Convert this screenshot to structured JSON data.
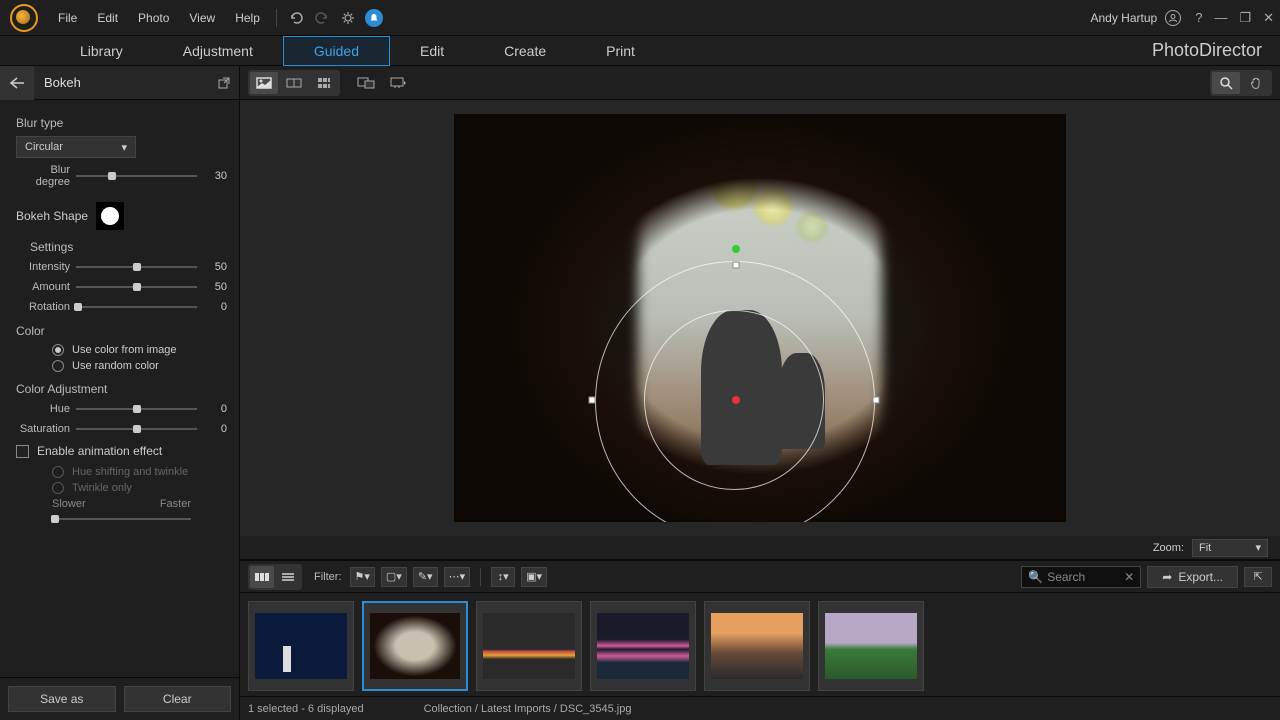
{
  "menu": {
    "file": "File",
    "edit": "Edit",
    "photo": "Photo",
    "view": "View",
    "help": "Help"
  },
  "user": {
    "name": "Andy Hartup"
  },
  "brand": "PhotoDirector",
  "tabs": {
    "library": "Library",
    "adjustment": "Adjustment",
    "guided": "Guided",
    "edit": "Edit",
    "create": "Create",
    "print": "Print"
  },
  "panel": {
    "title": "Bokeh",
    "blur_type_label": "Blur type",
    "blur_type_value": "Circular",
    "blur_degree_label": "Blur degree",
    "blur_degree_value": "30",
    "bokeh_shape_label": "Bokeh Shape",
    "settings_label": "Settings",
    "intensity_label": "Intensity",
    "intensity_value": "50",
    "amount_label": "Amount",
    "amount_value": "50",
    "rotation_label": "Rotation",
    "rotation_value": "0",
    "color_label": "Color",
    "use_image_color": "Use color from image",
    "use_random_color": "Use random color",
    "color_adj_label": "Color Adjustment",
    "hue_label": "Hue",
    "hue_value": "0",
    "saturation_label": "Saturation",
    "saturation_value": "0",
    "enable_anim": "Enable animation effect",
    "hue_twinkle": "Hue shifting and twinkle",
    "twinkle_only": "Twinkle only",
    "slower": "Slower",
    "faster": "Faster",
    "save_as": "Save as",
    "clear": "Clear"
  },
  "zoom": {
    "label": "Zoom:",
    "value": "Fit"
  },
  "filmstrip": {
    "filter_label": "Filter:",
    "search_placeholder": "Search",
    "export": "Export..."
  },
  "status": {
    "selection": "1 selected - 6 displayed",
    "path": "Collection / Latest Imports / DSC_3545.jpg"
  }
}
